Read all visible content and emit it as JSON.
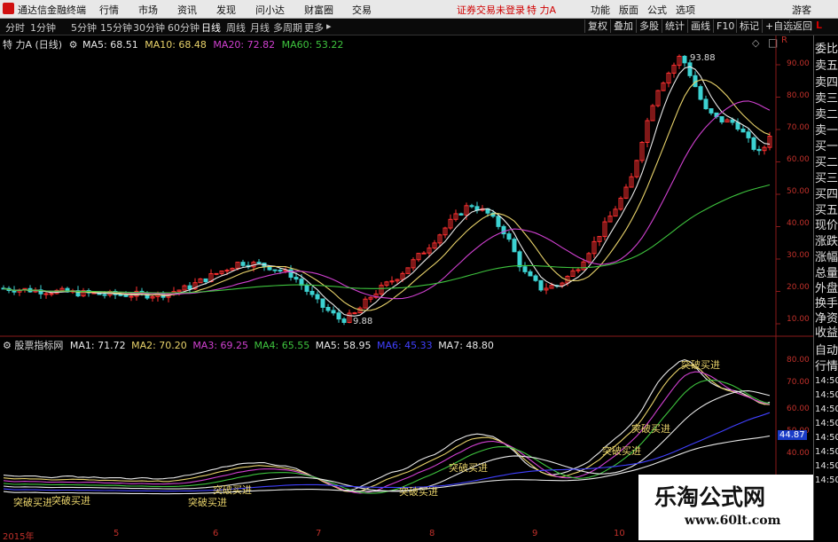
{
  "titlebar": {
    "app_title": "通达信金融终端",
    "menus": [
      "行情",
      "市场",
      "资讯",
      "发现",
      "问小达",
      "财富圈",
      "交易"
    ],
    "warning": "证券交易未登录",
    "stock_name": "特 力A",
    "right_menus": [
      "功能",
      "版面",
      "公式",
      "选项"
    ],
    "guest": "游客"
  },
  "periodbar": {
    "periods": [
      "分时",
      "1分钟",
      "5分钟",
      "15分钟",
      "30分钟",
      "60分钟",
      "日线",
      "周线",
      "月线",
      "多周期",
      "更多"
    ],
    "active": "日线",
    "right_buttons": [
      "复权",
      "叠加",
      "多股",
      "统计",
      "画线",
      "F10",
      "标记",
      "+自选",
      "返回"
    ]
  },
  "main_legend": {
    "name": "特 力A (日线)",
    "ma": [
      {
        "label": "MA5: 68.51",
        "color": "#e8e8e8"
      },
      {
        "label": "MA10: 68.48",
        "color": "#e8d26a"
      },
      {
        "label": "MA20: 72.82",
        "color": "#d040d0"
      },
      {
        "label": "MA60: 53.22",
        "color": "#3ec43e"
      }
    ]
  },
  "main_axis": [
    "90.00",
    "80.00",
    "70.00",
    "60.00",
    "50.00",
    "40.00",
    "30.00",
    "20.00",
    "10.00"
  ],
  "main_axis_top": "R",
  "price_labels": {
    "high": "93.88",
    "low": "9.88"
  },
  "sub_legend": {
    "name": "股票指标网",
    "ma": [
      {
        "label": "MA1: 71.72",
        "color": "#e8e8e8"
      },
      {
        "label": "MA2: 70.20",
        "color": "#e8d26a"
      },
      {
        "label": "MA3: 69.25",
        "color": "#d040d0"
      },
      {
        "label": "MA4: 65.55",
        "color": "#3ec43e"
      },
      {
        "label": "MA5: 58.95",
        "color": "#e8e8e8"
      },
      {
        "label": "MA6: 45.33",
        "color": "#4040ff"
      },
      {
        "label": "MA7: 48.80",
        "color": "#e8e8e8"
      }
    ]
  },
  "sub_axis": [
    "80.00",
    "70.00",
    "60.00",
    "50.00",
    "40.00"
  ],
  "sub_axis_value": "44.87",
  "breakout_signals": [
    "突破买进",
    "突破买进",
    "突破买进",
    "突破买进",
    "突破买进",
    "突破买进",
    "突破买进",
    "突破买进",
    "突破买进"
  ],
  "x_axis": [
    "2015年",
    "5",
    "6",
    "7",
    "8",
    "9",
    "10"
  ],
  "right_panel": {
    "top_letters": "L",
    "labels": [
      "委比",
      "卖五",
      "卖四",
      "卖三",
      "卖二",
      "卖一",
      "买一",
      "买二",
      "买三",
      "买四",
      "买五",
      "现价",
      "涨跌",
      "涨幅",
      "总量",
      "外盘",
      "换手",
      "净资",
      "收益",
      "自动",
      "行情"
    ],
    "times": [
      "14:50",
      "14:50",
      "14:50",
      "14:50",
      "14:50",
      "14:50",
      "14:50",
      "14:50"
    ]
  },
  "watermark": {
    "title": "乐淘公式网",
    "url": "www.60lt.com"
  }
}
